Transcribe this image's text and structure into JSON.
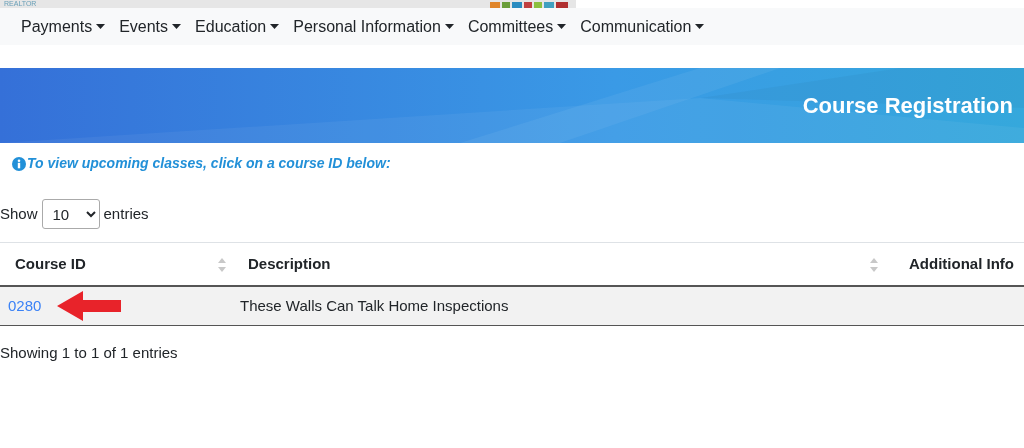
{
  "header": {
    "logo_text": "REALTOR"
  },
  "nav": [
    {
      "label": "Payments"
    },
    {
      "label": "Events"
    },
    {
      "label": "Education"
    },
    {
      "label": "Personal Information"
    },
    {
      "label": "Committees"
    },
    {
      "label": "Communication"
    }
  ],
  "banner": {
    "title": "Course Registration"
  },
  "info": "To view upcoming classes, click on a course ID below:",
  "length": {
    "before": "Show",
    "value": "10",
    "after": "entries"
  },
  "table": {
    "columns": [
      {
        "label": "Course ID",
        "sortable": true
      },
      {
        "label": "Description",
        "sortable": true
      },
      {
        "label": "Additional Info",
        "sortable": false
      }
    ],
    "rows": [
      {
        "course_id": "0280",
        "description": "These Walls Can Talk Home Inspections",
        "additional_info": "",
        "arrow": true
      }
    ]
  },
  "summary": "Showing 1 to 1 of 1 entries"
}
